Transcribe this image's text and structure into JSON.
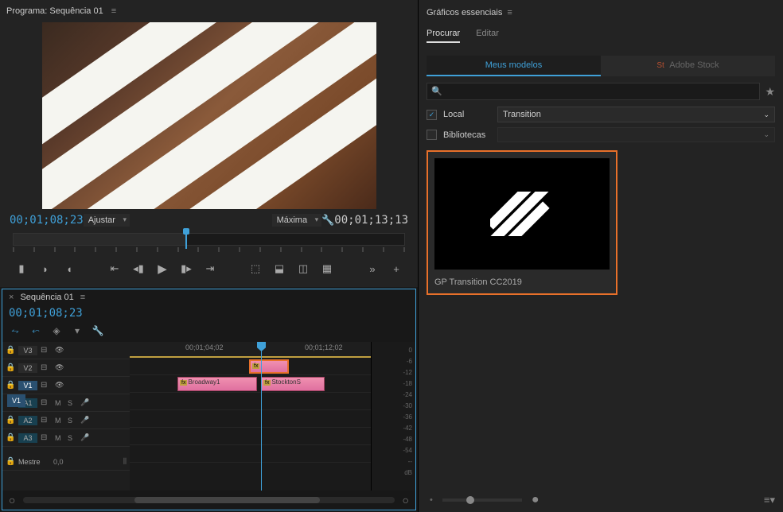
{
  "program": {
    "panel_title": "Programa: Sequência 01",
    "timecode_current": "00;01;08;23",
    "timecode_duration": "00;01;13;13",
    "fit_label": "Ajustar",
    "quality_label": "Máxima"
  },
  "timeline": {
    "tab_title": "Sequência 01",
    "timecode": "00;01;08;23",
    "ruler_t1": "00;01;04;02",
    "ruler_t2": "00;01;12;02",
    "tracks": {
      "v3": "V3",
      "v2": "V2",
      "v1": "V1",
      "a1": "A1",
      "a2": "A2",
      "a3": "A3",
      "master": "Mestre",
      "master_val": "0,0"
    },
    "mute": "M",
    "solo": "S",
    "clips": {
      "c1_fx": "fx",
      "c1_label": "Broadway1",
      "c2_fx": "fx",
      "c2_label": "StocktonS",
      "c3_fx": "fx"
    }
  },
  "meters": {
    "db_label": "dB",
    "scale": [
      "0",
      "-6",
      "-12",
      "-18",
      "-24",
      "-30",
      "-36",
      "-42",
      "-48",
      "-54",
      "--"
    ]
  },
  "eg": {
    "panel_title": "Gráficos essenciais",
    "tab_browse": "Procurar",
    "tab_edit": "Editar",
    "subtab_mine": "Meus modelos",
    "subtab_stock": "Adobe Stock",
    "stock_icon": "St",
    "filter_local": "Local",
    "filter_libs": "Bibliotecas",
    "filter_transition": "Transition",
    "template_name": "GP Transition CC2019"
  }
}
